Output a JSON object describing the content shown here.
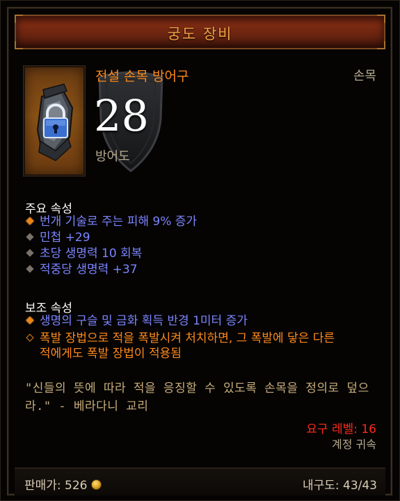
{
  "header": {
    "title": "궁도 장비"
  },
  "item": {
    "name": "전설 손목 방어구",
    "slot": "손목",
    "armor_value": "28",
    "armor_label": "방어도",
    "icon": "lock-icon",
    "rarity_color": "#ff8a1c"
  },
  "primary": {
    "title": "주요 속성",
    "attributes": [
      "번개 기술로 주는 피해 9% 증가",
      "민첩 +29",
      "초당 생명력 10 회복",
      "적중당 생명력 +37"
    ]
  },
  "secondary": {
    "title": "보조 속성",
    "attributes": [
      "생명의 구슬 및 금화 획득 반경 1미터 증가",
      "폭발 장법으로 적을 폭발시켜 처치하면, 그 폭발에 닿은 다른",
      "적에게도 폭발 장법이 적용됨"
    ]
  },
  "flavor": {
    "line1": "\"신들의 뜻에 따라 적을 응징할 수 있도록 손목을 정의로 덮으",
    "line2": "라.\" - 베라다니 교리"
  },
  "requirements": {
    "level": "요구 레벨: 16",
    "binding": "계정 귀속"
  },
  "footer": {
    "sell_price": "판매가: 526",
    "durability": "내구도: 43/43"
  },
  "colors": {
    "legendary": "#ff8a1c",
    "magic": "#7c85ff",
    "requirement": "#ff2a1a"
  }
}
